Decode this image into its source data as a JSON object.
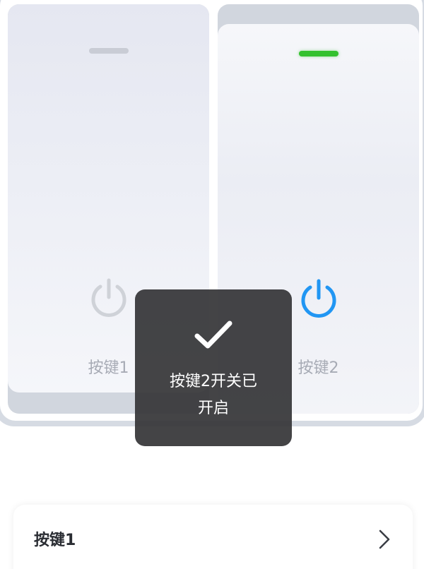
{
  "keys": [
    {
      "label": "按键1",
      "state": "off",
      "indicator_color": "#c9ccd5",
      "icon": "power-icon",
      "icon_color": "#cfd2d8"
    },
    {
      "label": "按键2",
      "state": "on",
      "indicator_color": "#33c12e",
      "icon": "power-icon",
      "icon_color": "#2196f3"
    }
  ],
  "toast": {
    "icon": "checkmark-icon",
    "line1": "按键2开关已",
    "line2": "开启"
  },
  "list": {
    "items": [
      {
        "label": "按键1",
        "icon": "chevron-right-icon"
      }
    ]
  },
  "colors": {
    "accent": "#2196f3",
    "on_indicator": "#33c12e",
    "toast_bg": "#343436"
  }
}
